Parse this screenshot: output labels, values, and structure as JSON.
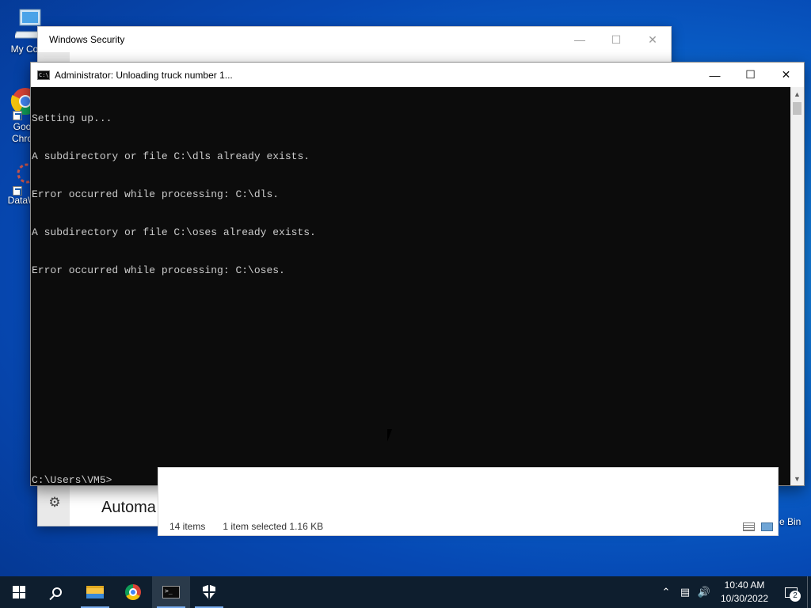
{
  "desktop": {
    "icons": [
      {
        "label": "My Com",
        "icon": "computer-icon"
      },
      {
        "label": "Goo\nChro",
        "icon": "chrome-icon"
      },
      {
        "label": "DataW",
        "icon": "datawrapper-icon"
      }
    ],
    "recycle_bin_label": "e Bin"
  },
  "windows_security": {
    "title": "Windows Security",
    "heading": "Automa"
  },
  "cmd": {
    "title": "Administrator:  Unloading truck number 1...",
    "lines": [
      "Setting up...",
      "A subdirectory or file C:\\dls already exists.",
      "Error occurred while processing: C:\\dls.",
      "A subdirectory or file C:\\oses already exists.",
      "Error occurred while processing: C:\\oses."
    ],
    "prompt": "C:\\Users\\VM5>"
  },
  "explorer": {
    "item_count": "14 items",
    "selection": "1 item selected  1.16 KB"
  },
  "taskbar": {
    "apps": [
      "start",
      "search",
      "file-explorer",
      "chrome",
      "command-prompt",
      "windows-security"
    ],
    "time": "10:40 AM",
    "date": "10/30/2022",
    "notification_count": "2"
  },
  "colors": {
    "desktop_accent": "#0a68cf",
    "taskbar": "#0e1e2e",
    "console_bg": "#0c0c0c",
    "console_fg": "#cccccc"
  }
}
